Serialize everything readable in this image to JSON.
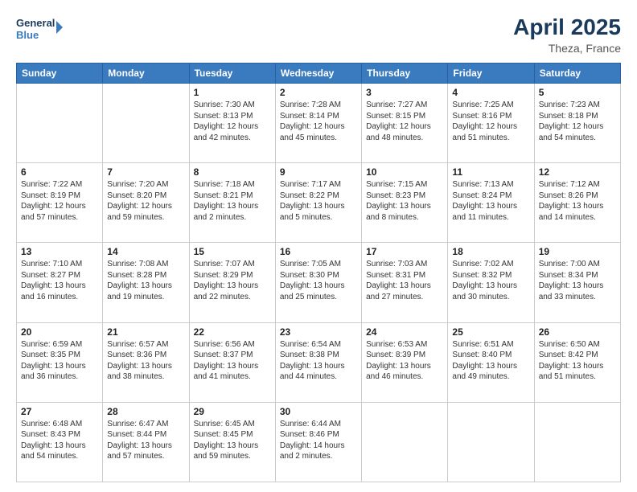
{
  "header": {
    "logo_line1": "General",
    "logo_line2": "Blue",
    "title": "April 2025",
    "subtitle": "Theza, France"
  },
  "columns": [
    "Sunday",
    "Monday",
    "Tuesday",
    "Wednesday",
    "Thursday",
    "Friday",
    "Saturday"
  ],
  "weeks": [
    [
      {
        "day": "",
        "info": ""
      },
      {
        "day": "",
        "info": ""
      },
      {
        "day": "1",
        "info": "Sunrise: 7:30 AM\nSunset: 8:13 PM\nDaylight: 12 hours\nand 42 minutes."
      },
      {
        "day": "2",
        "info": "Sunrise: 7:28 AM\nSunset: 8:14 PM\nDaylight: 12 hours\nand 45 minutes."
      },
      {
        "day": "3",
        "info": "Sunrise: 7:27 AM\nSunset: 8:15 PM\nDaylight: 12 hours\nand 48 minutes."
      },
      {
        "day": "4",
        "info": "Sunrise: 7:25 AM\nSunset: 8:16 PM\nDaylight: 12 hours\nand 51 minutes."
      },
      {
        "day": "5",
        "info": "Sunrise: 7:23 AM\nSunset: 8:18 PM\nDaylight: 12 hours\nand 54 minutes."
      }
    ],
    [
      {
        "day": "6",
        "info": "Sunrise: 7:22 AM\nSunset: 8:19 PM\nDaylight: 12 hours\nand 57 minutes."
      },
      {
        "day": "7",
        "info": "Sunrise: 7:20 AM\nSunset: 8:20 PM\nDaylight: 12 hours\nand 59 minutes."
      },
      {
        "day": "8",
        "info": "Sunrise: 7:18 AM\nSunset: 8:21 PM\nDaylight: 13 hours\nand 2 minutes."
      },
      {
        "day": "9",
        "info": "Sunrise: 7:17 AM\nSunset: 8:22 PM\nDaylight: 13 hours\nand 5 minutes."
      },
      {
        "day": "10",
        "info": "Sunrise: 7:15 AM\nSunset: 8:23 PM\nDaylight: 13 hours\nand 8 minutes."
      },
      {
        "day": "11",
        "info": "Sunrise: 7:13 AM\nSunset: 8:24 PM\nDaylight: 13 hours\nand 11 minutes."
      },
      {
        "day": "12",
        "info": "Sunrise: 7:12 AM\nSunset: 8:26 PM\nDaylight: 13 hours\nand 14 minutes."
      }
    ],
    [
      {
        "day": "13",
        "info": "Sunrise: 7:10 AM\nSunset: 8:27 PM\nDaylight: 13 hours\nand 16 minutes."
      },
      {
        "day": "14",
        "info": "Sunrise: 7:08 AM\nSunset: 8:28 PM\nDaylight: 13 hours\nand 19 minutes."
      },
      {
        "day": "15",
        "info": "Sunrise: 7:07 AM\nSunset: 8:29 PM\nDaylight: 13 hours\nand 22 minutes."
      },
      {
        "day": "16",
        "info": "Sunrise: 7:05 AM\nSunset: 8:30 PM\nDaylight: 13 hours\nand 25 minutes."
      },
      {
        "day": "17",
        "info": "Sunrise: 7:03 AM\nSunset: 8:31 PM\nDaylight: 13 hours\nand 27 minutes."
      },
      {
        "day": "18",
        "info": "Sunrise: 7:02 AM\nSunset: 8:32 PM\nDaylight: 13 hours\nand 30 minutes."
      },
      {
        "day": "19",
        "info": "Sunrise: 7:00 AM\nSunset: 8:34 PM\nDaylight: 13 hours\nand 33 minutes."
      }
    ],
    [
      {
        "day": "20",
        "info": "Sunrise: 6:59 AM\nSunset: 8:35 PM\nDaylight: 13 hours\nand 36 minutes."
      },
      {
        "day": "21",
        "info": "Sunrise: 6:57 AM\nSunset: 8:36 PM\nDaylight: 13 hours\nand 38 minutes."
      },
      {
        "day": "22",
        "info": "Sunrise: 6:56 AM\nSunset: 8:37 PM\nDaylight: 13 hours\nand 41 minutes."
      },
      {
        "day": "23",
        "info": "Sunrise: 6:54 AM\nSunset: 8:38 PM\nDaylight: 13 hours\nand 44 minutes."
      },
      {
        "day": "24",
        "info": "Sunrise: 6:53 AM\nSunset: 8:39 PM\nDaylight: 13 hours\nand 46 minutes."
      },
      {
        "day": "25",
        "info": "Sunrise: 6:51 AM\nSunset: 8:40 PM\nDaylight: 13 hours\nand 49 minutes."
      },
      {
        "day": "26",
        "info": "Sunrise: 6:50 AM\nSunset: 8:42 PM\nDaylight: 13 hours\nand 51 minutes."
      }
    ],
    [
      {
        "day": "27",
        "info": "Sunrise: 6:48 AM\nSunset: 8:43 PM\nDaylight: 13 hours\nand 54 minutes."
      },
      {
        "day": "28",
        "info": "Sunrise: 6:47 AM\nSunset: 8:44 PM\nDaylight: 13 hours\nand 57 minutes."
      },
      {
        "day": "29",
        "info": "Sunrise: 6:45 AM\nSunset: 8:45 PM\nDaylight: 13 hours\nand 59 minutes."
      },
      {
        "day": "30",
        "info": "Sunrise: 6:44 AM\nSunset: 8:46 PM\nDaylight: 14 hours\nand 2 minutes."
      },
      {
        "day": "",
        "info": ""
      },
      {
        "day": "",
        "info": ""
      },
      {
        "day": "",
        "info": ""
      }
    ]
  ]
}
